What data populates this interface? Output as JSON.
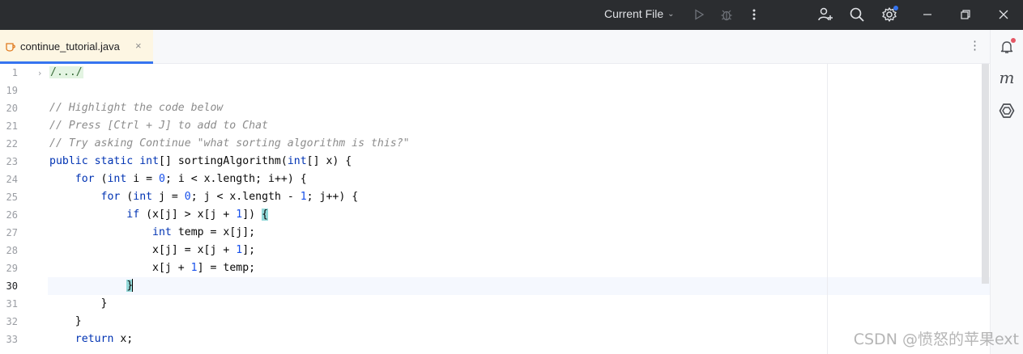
{
  "titlebar": {
    "run_config": "Current File",
    "icons": [
      "run-icon",
      "debug-icon",
      "more-vertical-icon",
      "add-user-icon",
      "search-icon",
      "settings-icon",
      "minimize-icon",
      "restore-icon",
      "close-icon"
    ]
  },
  "tab": {
    "label": "continue_tutorial.java",
    "close": "×",
    "icon": "java-file-icon"
  },
  "editor": {
    "lines": [
      {
        "num": "1",
        "text": "/.../"
      },
      {
        "num": "19",
        "text": ""
      },
      {
        "num": "20",
        "text": "// Highlight the code below"
      },
      {
        "num": "21",
        "text": "// Press [Ctrl + J] to add to Chat"
      },
      {
        "num": "22",
        "text": "// Try asking Continue \"what sorting algorithm is this?\""
      },
      {
        "num": "23",
        "text": "public static int[] sortingAlgorithm(int[] x) {"
      },
      {
        "num": "24",
        "text": "    for (int i = 0; i < x.length; i++) {"
      },
      {
        "num": "25",
        "text": "        for (int j = 0; j < x.length - 1; j++) {"
      },
      {
        "num": "26",
        "text": "            if (x[j] > x[j + 1]) {"
      },
      {
        "num": "27",
        "text": "                int temp = x[j];"
      },
      {
        "num": "28",
        "text": "                x[j] = x[j + 1];"
      },
      {
        "num": "29",
        "text": "                x[j + 1] = temp;"
      },
      {
        "num": "30",
        "text": "            }"
      },
      {
        "num": "31",
        "text": "        }"
      },
      {
        "num": "32",
        "text": "    }"
      },
      {
        "num": "33",
        "text": "    return x;"
      }
    ],
    "current_line": "30"
  },
  "rightstrip": {
    "icons": [
      "notifications-icon",
      "maven-icon",
      "continue-icon"
    ],
    "maven_letter": "m"
  },
  "watermark": "CSDN @愤怒的苹果ext",
  "colors": {
    "titlebar_bg": "#2b2d30",
    "tab_active_bg": "#fdf6e3",
    "accent": "#3574f0",
    "keyword": "#0033b3",
    "number": "#1750eb",
    "comment": "#8c8c8c"
  }
}
